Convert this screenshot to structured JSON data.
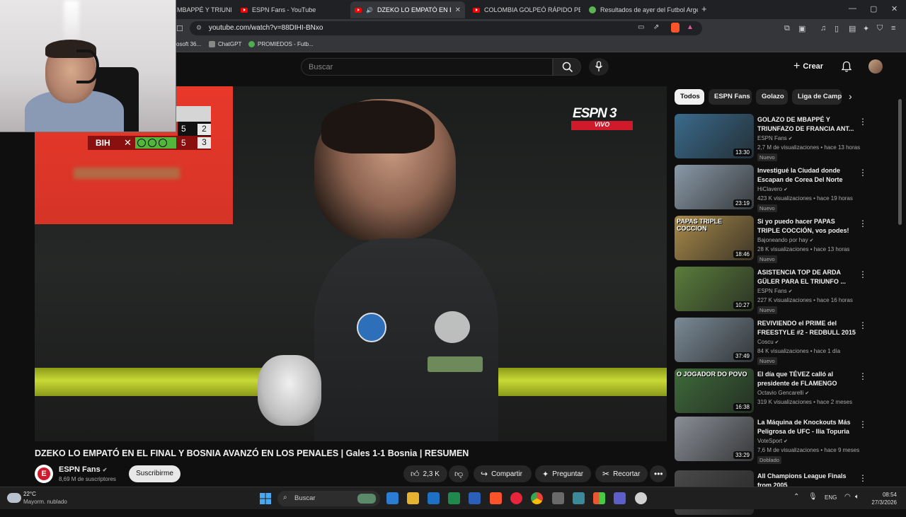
{
  "browser": {
    "tabs": [
      {
        "label": "MBAPPÉ Y TRIUNFAZO",
        "icon": "youtube-favicon-icon"
      },
      {
        "label": "ESPN Fans - YouTube",
        "icon": "youtube-favicon-icon"
      },
      {
        "label": "DZEKO LO EMPATÓ EN EL FIN",
        "icon": "youtube-favicon-icon",
        "active": true
      },
      {
        "label": "COLOMBIA GOLPEÓ RÁPIDO PERO S",
        "icon": "youtube-favicon-icon"
      },
      {
        "label": "Resultados de ayer del Futbol Argen",
        "icon": "green-favicon-icon"
      }
    ],
    "new_tab": "+",
    "url": "youtube.com/watch?v=88DIHI-BNxo",
    "bookmarks": [
      "osoft 36...",
      "ChatGPT",
      "PROMIEDOS - Futb..."
    ]
  },
  "youtube": {
    "search_placeholder": "Buscar",
    "create_label": "Crear"
  },
  "player": {
    "channel_bug": "ESPN 3",
    "live_label": "VIVO",
    "scoreboard": {
      "team_bottom": "BIH",
      "rows": [
        {
          "score": "5",
          "shots": "2"
        },
        {
          "score": "5",
          "shots": "3"
        }
      ]
    }
  },
  "video": {
    "title": "DZEKO LO EMPATÓ EN EL FINAL Y BOSNIA AVANZÓ EN LOS PENALES | Gales 1-1 Bosnia | RESUMEN",
    "channel": "ESPN Fans",
    "subscribers": "8,69 M de suscriptores",
    "subscribe_label": "Suscribirme",
    "likes": "2,3 K",
    "share_label": "Compartir",
    "ask_label": "Preguntar",
    "clip_label": "Recortar"
  },
  "chips": [
    "Todos",
    "ESPN Fans",
    "Golazo",
    "Liga de Campe"
  ],
  "recommendations": [
    {
      "title": "GOLAZO DE MBAPPÉ Y TRIUNFAZO DE FRANCIA ANT...",
      "channel": "ESPN Fans",
      "meta": "2,7 M de visualizaciones • hace 13 horas",
      "badge": "Nuevo",
      "duration": "13:30",
      "thumb_color": "#3a6b8c"
    },
    {
      "title": "Investigué la Ciudad donde Escapan de Corea Del Norte",
      "channel": "HiClavero",
      "meta": "423 K visualizaciones • hace 19 horas",
      "badge": "Nuevo",
      "duration": "23:19",
      "thumb_color": "#8a9aa8"
    },
    {
      "title": "Si yo puedo hacer PAPAS TRIPLE COCCIÓN, vos podes!",
      "channel": "Bajoneando por hay",
      "meta": "28 K visualizaciones • hace 13 horas",
      "badge": "Nuevo",
      "duration": "18:46",
      "thumb_color": "#a88a4a",
      "thumb_text": "PAPAS TRIPLE COCCION"
    },
    {
      "title": "ASISTENCIA TOP DE ARDA GÜLER PARA EL TRIUNFO ...",
      "channel": "ESPN Fans",
      "meta": "227 K visualizaciones • hace 16 horas",
      "badge": "Nuevo",
      "duration": "10:27",
      "thumb_color": "#5b7d3c"
    },
    {
      "title": "REVIVIENDO el PRIME del FREESTYLE #2 - REDBULL 2015",
      "channel": "Coscu",
      "meta": "84 K visualizaciones • hace 1 día",
      "badge": "Nuevo",
      "duration": "37:49",
      "thumb_color": "#7a8a96"
    },
    {
      "title": "El día que TÉVEZ calló al presidente de FLAMENGO",
      "channel": "Octavio Gencarelli",
      "meta": "319 K visualizaciones • hace 2 meses",
      "badge": "",
      "duration": "16:38",
      "thumb_color": "#3e6b3a",
      "thumb_text": "O JOGADOR DO POVO"
    },
    {
      "title": "La Máquina de Knockouts Más Peligrosa de UFC - Ilia Topuria",
      "channel": "VoteSport",
      "meta": "7,6 M de visualizaciones • hace 9 meses",
      "badge": "Doblado",
      "duration": "33:29",
      "thumb_color": "#8a8f96"
    },
    {
      "title": "All Champions League Finals from 2005",
      "channel": "",
      "meta": "",
      "badge": "",
      "duration": "",
      "thumb_color": "#4a4a4a"
    }
  ],
  "taskbar": {
    "weather_temp": "22°C",
    "weather_desc": "Mayorm. nublado",
    "search_label": "Buscar",
    "language": "ENG",
    "time": "08:54",
    "date": "27/3/2026"
  }
}
